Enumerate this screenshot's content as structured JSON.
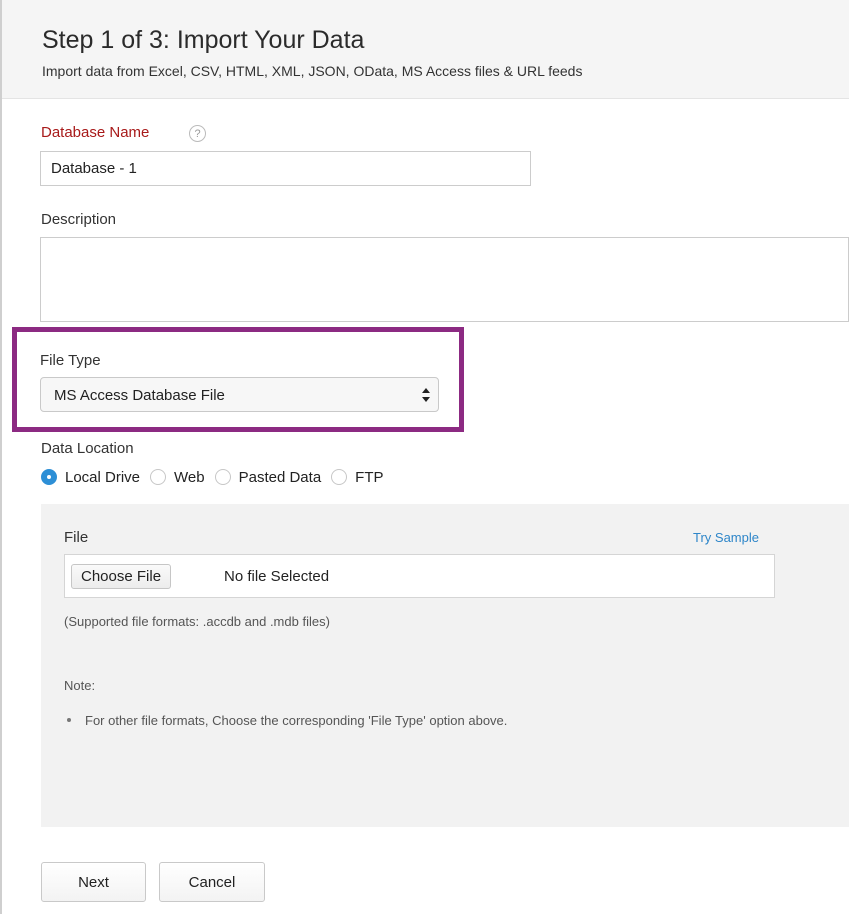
{
  "header": {
    "title": "Step 1 of 3: Import Your Data",
    "subtitle": "Import data from Excel, CSV, HTML, XML, JSON, OData, MS Access files & URL feeds"
  },
  "database_name": {
    "label": "Database Name",
    "help_glyph": "?",
    "value": "Database - 1"
  },
  "description": {
    "label": "Description",
    "value": ""
  },
  "file_type": {
    "label": "File Type",
    "selected": "MS Access Database File"
  },
  "data_location": {
    "label": "Data Location",
    "options": [
      "Local Drive",
      "Web",
      "Pasted Data",
      "FTP"
    ],
    "selected": "Local Drive"
  },
  "file_panel": {
    "file_label": "File",
    "try_sample": "Try Sample",
    "choose_file": "Choose File",
    "file_status": "No file Selected",
    "supported_formats": "(Supported file formats: .accdb and .mdb files)",
    "note_title": "Note:",
    "note_items": [
      "For other file formats, Choose the corresponding 'File Type' option above."
    ]
  },
  "actions": {
    "next": "Next",
    "cancel": "Cancel"
  },
  "colors": {
    "required_label": "#a81a1a",
    "highlight_border": "#8c2a82",
    "radio_selected": "#2d8fd6",
    "link": "#2e86c9"
  }
}
